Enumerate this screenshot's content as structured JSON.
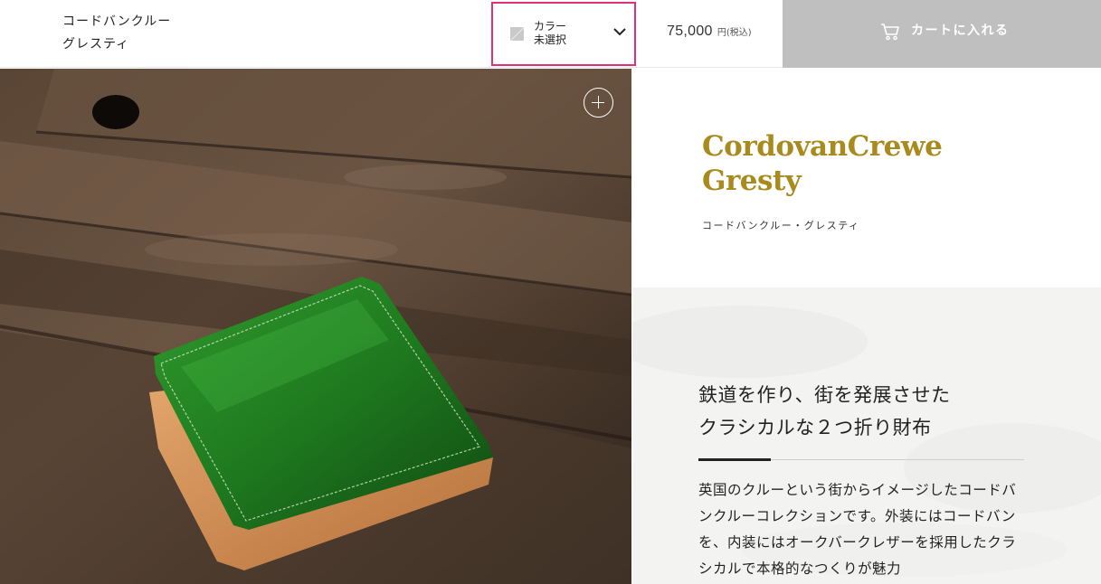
{
  "header": {
    "product_name": "コードバンクルー\nグレスティ",
    "color_select": {
      "label": "カラー",
      "value": "未選択",
      "highlight_color": "#e0307a"
    },
    "price": {
      "amount": "75,000",
      "unit": "円(税込)"
    },
    "cart_button": {
      "label": "カートに入れる",
      "icon": "cart-icon",
      "background": "#bfbfbf"
    }
  },
  "gallery": {
    "zoom_icon": "plus-icon"
  },
  "product": {
    "title_en": "CordovanCrewe\nGresty",
    "title_ja": "コードバンクルー・グレスティ",
    "accent_color": "#a88a1e",
    "headline": "鉄道を作り、街を発展させた\nクラシカルな２つ折り財布",
    "description": "英国のクルーという街からイメージしたコードバンクルーコレクションです。外装にはコードバンを、内装にはオークバークレザーを採用したクラシカルで本格的なつくりが魅力"
  }
}
